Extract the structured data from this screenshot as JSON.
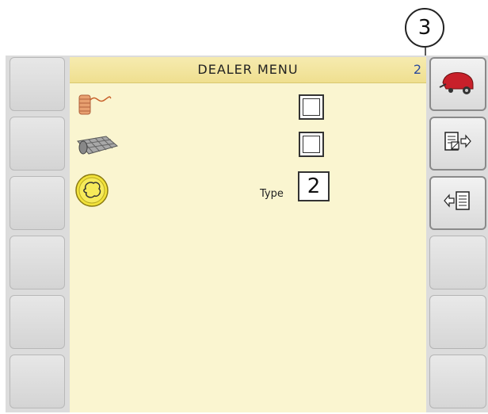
{
  "callout": {
    "number": "3"
  },
  "screen": {
    "title": "DEALER MENU",
    "page": "2",
    "rows": [
      {
        "icon": "twine-icon",
        "control": "checkbox",
        "checked": false
      },
      {
        "icon": "net-wrap-icon",
        "control": "checkbox",
        "checked": false
      },
      {
        "icon": "knotter-type-icon",
        "control": "value",
        "label": "Type",
        "value": "2"
      }
    ]
  },
  "right_softkeys": [
    {
      "icon": "baler-icon",
      "active": true
    },
    {
      "icon": "export-settings-icon",
      "active": true
    },
    {
      "icon": "import-settings-icon",
      "active": true
    },
    {
      "icon": "",
      "active": false
    },
    {
      "icon": "",
      "active": false
    },
    {
      "icon": "",
      "active": false
    }
  ],
  "left_softkeys": [
    {
      "icon": ""
    },
    {
      "icon": ""
    },
    {
      "icon": ""
    },
    {
      "icon": ""
    },
    {
      "icon": ""
    },
    {
      "icon": ""
    }
  ],
  "colors": {
    "screen_bg": "#faf5d0",
    "titlebar": "#efdf8f",
    "page_number": "#2c4b9c",
    "baler_red": "#c8202a"
  }
}
